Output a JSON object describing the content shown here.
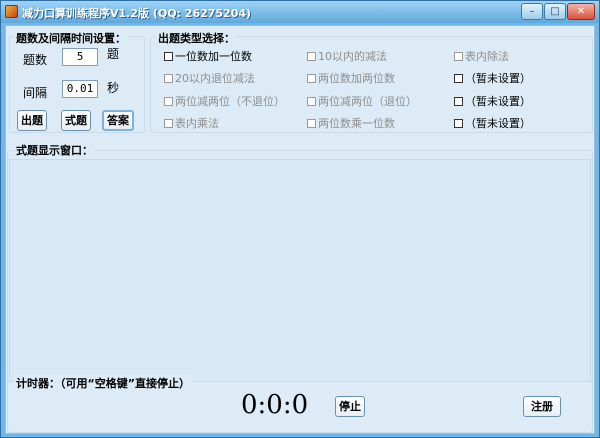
{
  "window": {
    "title": "减力口算训练程序V1.2版  (QQ: 26275204)",
    "controls": {
      "minimize": "–",
      "maximize": "□",
      "close": "✕"
    }
  },
  "settings": {
    "group_label": "题数及间隔时间设置：",
    "count_label": "题数",
    "count_value": "5",
    "count_unit": "题",
    "interval_label": "间隔",
    "interval_value": "0.01",
    "interval_unit": "秒",
    "buttons": {
      "issue": "出题",
      "formula": "式题",
      "answer": "答案"
    }
  },
  "types": {
    "group_label": "出题类型选择：",
    "col1": [
      "一位数加一位数",
      "20以内退位减法",
      "两位减两位（不退位）",
      "表内乘法"
    ],
    "col2": [
      "10以内的减法",
      "两位数加两位数",
      "两位减两位（退位）",
      "两位数乘一位数"
    ],
    "col3": [
      "表内除法",
      "（暂未设置）",
      "（暂未设置）",
      "（暂未设置）"
    ]
  },
  "display": {
    "group_label": "式题显示窗口："
  },
  "timer": {
    "group_label": "计时器：（可用“空格键”直接停止）",
    "value": "0:0:0",
    "stop_label": "停止",
    "register_label": "注册"
  },
  "colors": {
    "titlebar": "#5fa9dc",
    "client_bg": "#dcebf6",
    "disabled_text": "#8e8e8e"
  }
}
